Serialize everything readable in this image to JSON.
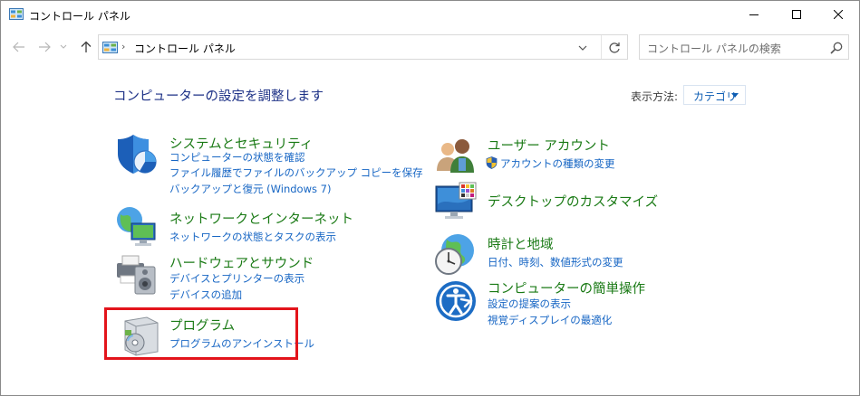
{
  "window": {
    "title": "コントロール パネル"
  },
  "address": {
    "path": "コントロール パネル",
    "separator": "›"
  },
  "search": {
    "placeholder": "コントロール パネルの検索"
  },
  "content": {
    "heading": "コンピューターの設定を調整します",
    "view_by_label": "表示方法:",
    "view_by_value": "カテゴリ"
  },
  "categories": {
    "system": {
      "title": "システムとセキュリティ",
      "links": [
        "コンピューターの状態を確認",
        "ファイル履歴でファイルのバックアップ コピーを保存",
        "バックアップと復元 (Windows 7)"
      ]
    },
    "network": {
      "title": "ネットワークとインターネット",
      "links": [
        "ネットワークの状態とタスクの表示"
      ]
    },
    "hardware": {
      "title": "ハードウェアとサウンド",
      "links": [
        "デバイスとプリンターの表示",
        "デバイスの追加"
      ]
    },
    "programs": {
      "title": "プログラム",
      "links": [
        "プログラムのアンインストール"
      ]
    },
    "users": {
      "title": "ユーザー アカウント",
      "links": [
        "アカウントの種類の変更"
      ]
    },
    "appearance": {
      "title": "デスクトップのカスタマイズ",
      "links": []
    },
    "clock": {
      "title": "時計と地域",
      "links": [
        "日付、時刻、数値形式の変更"
      ]
    },
    "ease": {
      "title": "コンピューターの簡単操作",
      "links": [
        "設定の提案の表示",
        "視覚ディスプレイの最適化"
      ]
    }
  },
  "colors": {
    "category_title": "#1a7a15",
    "link": "#1766c4",
    "heading": "#1e3287",
    "highlight": "#e3141b"
  }
}
